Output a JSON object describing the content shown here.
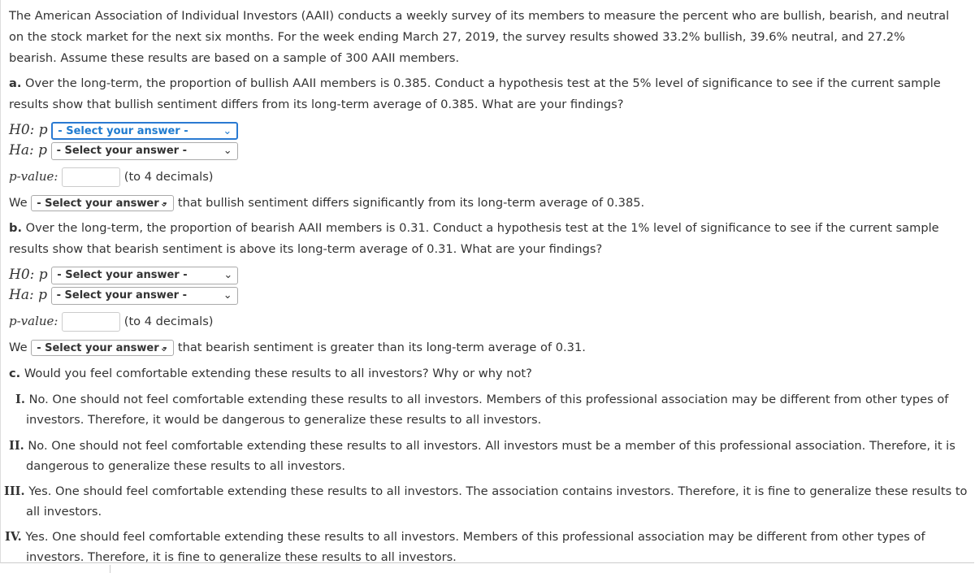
{
  "intro": [
    "The American Association of Individual Investors (AAII) conducts a weekly survey of its members to measure the percent who are bullish, bearish, and neutral",
    "on the stock market for the next six months. For the week ending March 27, 2019, the survey results showed 33.2% bullish, 39.6% neutral, and 27.2%",
    "bearish. Assume these results are based on a sample of 300 AAII members."
  ],
  "a": {
    "label": "a.",
    "text1": " Over the long-term, the proportion of bullish AAII members is 0.385. Conduct a hypothesis test at the 5% level of significance to see if the current sample",
    "text2": "results show that bullish sentiment differs from its long-term average of 0.385. What are your findings?",
    "h0": "H0: p",
    "ha": "Ha: p",
    "h0_select": "- Select your answer -",
    "ha_select": "- Select your answer -",
    "pvalue_label": "p-value:",
    "pvalue": "",
    "decimals": "(to 4 decimals)",
    "we": "We",
    "we_select": "- Select your answer -",
    "conclusion": "that bullish sentiment differs significantly from its long-term average of 0.385."
  },
  "b": {
    "label": "b.",
    "text1": " Over the long-term, the proportion of bearish AAII members is 0.31. Conduct a hypothesis test at the 1% level of significance to see if the current sample",
    "text2": "results show that bearish sentiment is above its long-term average of 0.31. What are your findings?",
    "h0": "H0: p",
    "ha": "Ha: p",
    "h0_select": "- Select your answer -",
    "ha_select": "- Select your answer -",
    "pvalue_label": "p-value:",
    "pvalue": "",
    "decimals": "(to 4 decimals)",
    "we": "We",
    "we_select": "- Select your answer -",
    "conclusion": "that bearish sentiment is greater than its long-term average of 0.31."
  },
  "c": {
    "label": "c.",
    "text": " Would you feel comfortable extending these results to all investors? Why or why not?",
    "options": [
      {
        "num": "I.",
        "l1": "No. One should not feel comfortable extending these results to all investors. Members of this professional association may be different from other types of",
        "l2": "investors. Therefore, it would be dangerous to generalize these results to all investors."
      },
      {
        "num": "II.",
        "l1": "No. One should not feel comfortable extending these results to all investors. All investors must be a member of this professional association. Therefore, it is",
        "l2": "dangerous to generalize these results to all investors."
      },
      {
        "num": "III.",
        "l1": "Yes. One should feel comfortable extending these results to all investors. The association contains investors. Therefore, it is fine to generalize these results to",
        "l2": "all investors."
      },
      {
        "num": "IV.",
        "l1": "Yes. One should feel comfortable extending these results to all investors. Members of this professional association may be different from other types of",
        "l2": "investors. Therefore, it is fine to generalize these results to all investors."
      }
    ]
  }
}
